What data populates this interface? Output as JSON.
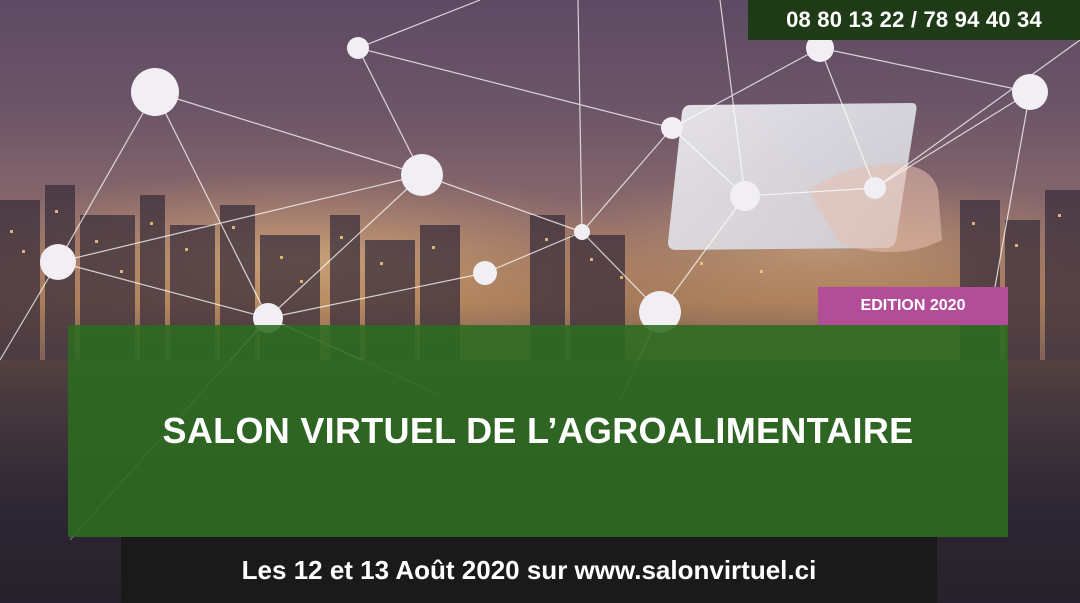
{
  "banner": {
    "phone": "08 80 13 22 / 78 94 40 34",
    "edition": "EDITION 2020",
    "title": "SALON VIRTUEL DE L’AGROALIMENTAIRE",
    "dates": "Les 12 et 13 Août 2020 sur www.salonvirtuel.ci"
  },
  "colors": {
    "phone_bg": "#1f3a16",
    "edition_bg": "#b24e97",
    "title_bg": "#2c6c20",
    "date_bg": "#1a1a1a"
  },
  "icons": {
    "network": "network-graph-icon",
    "tablet": "tablet-icon",
    "city": "city-skyline-icon"
  }
}
